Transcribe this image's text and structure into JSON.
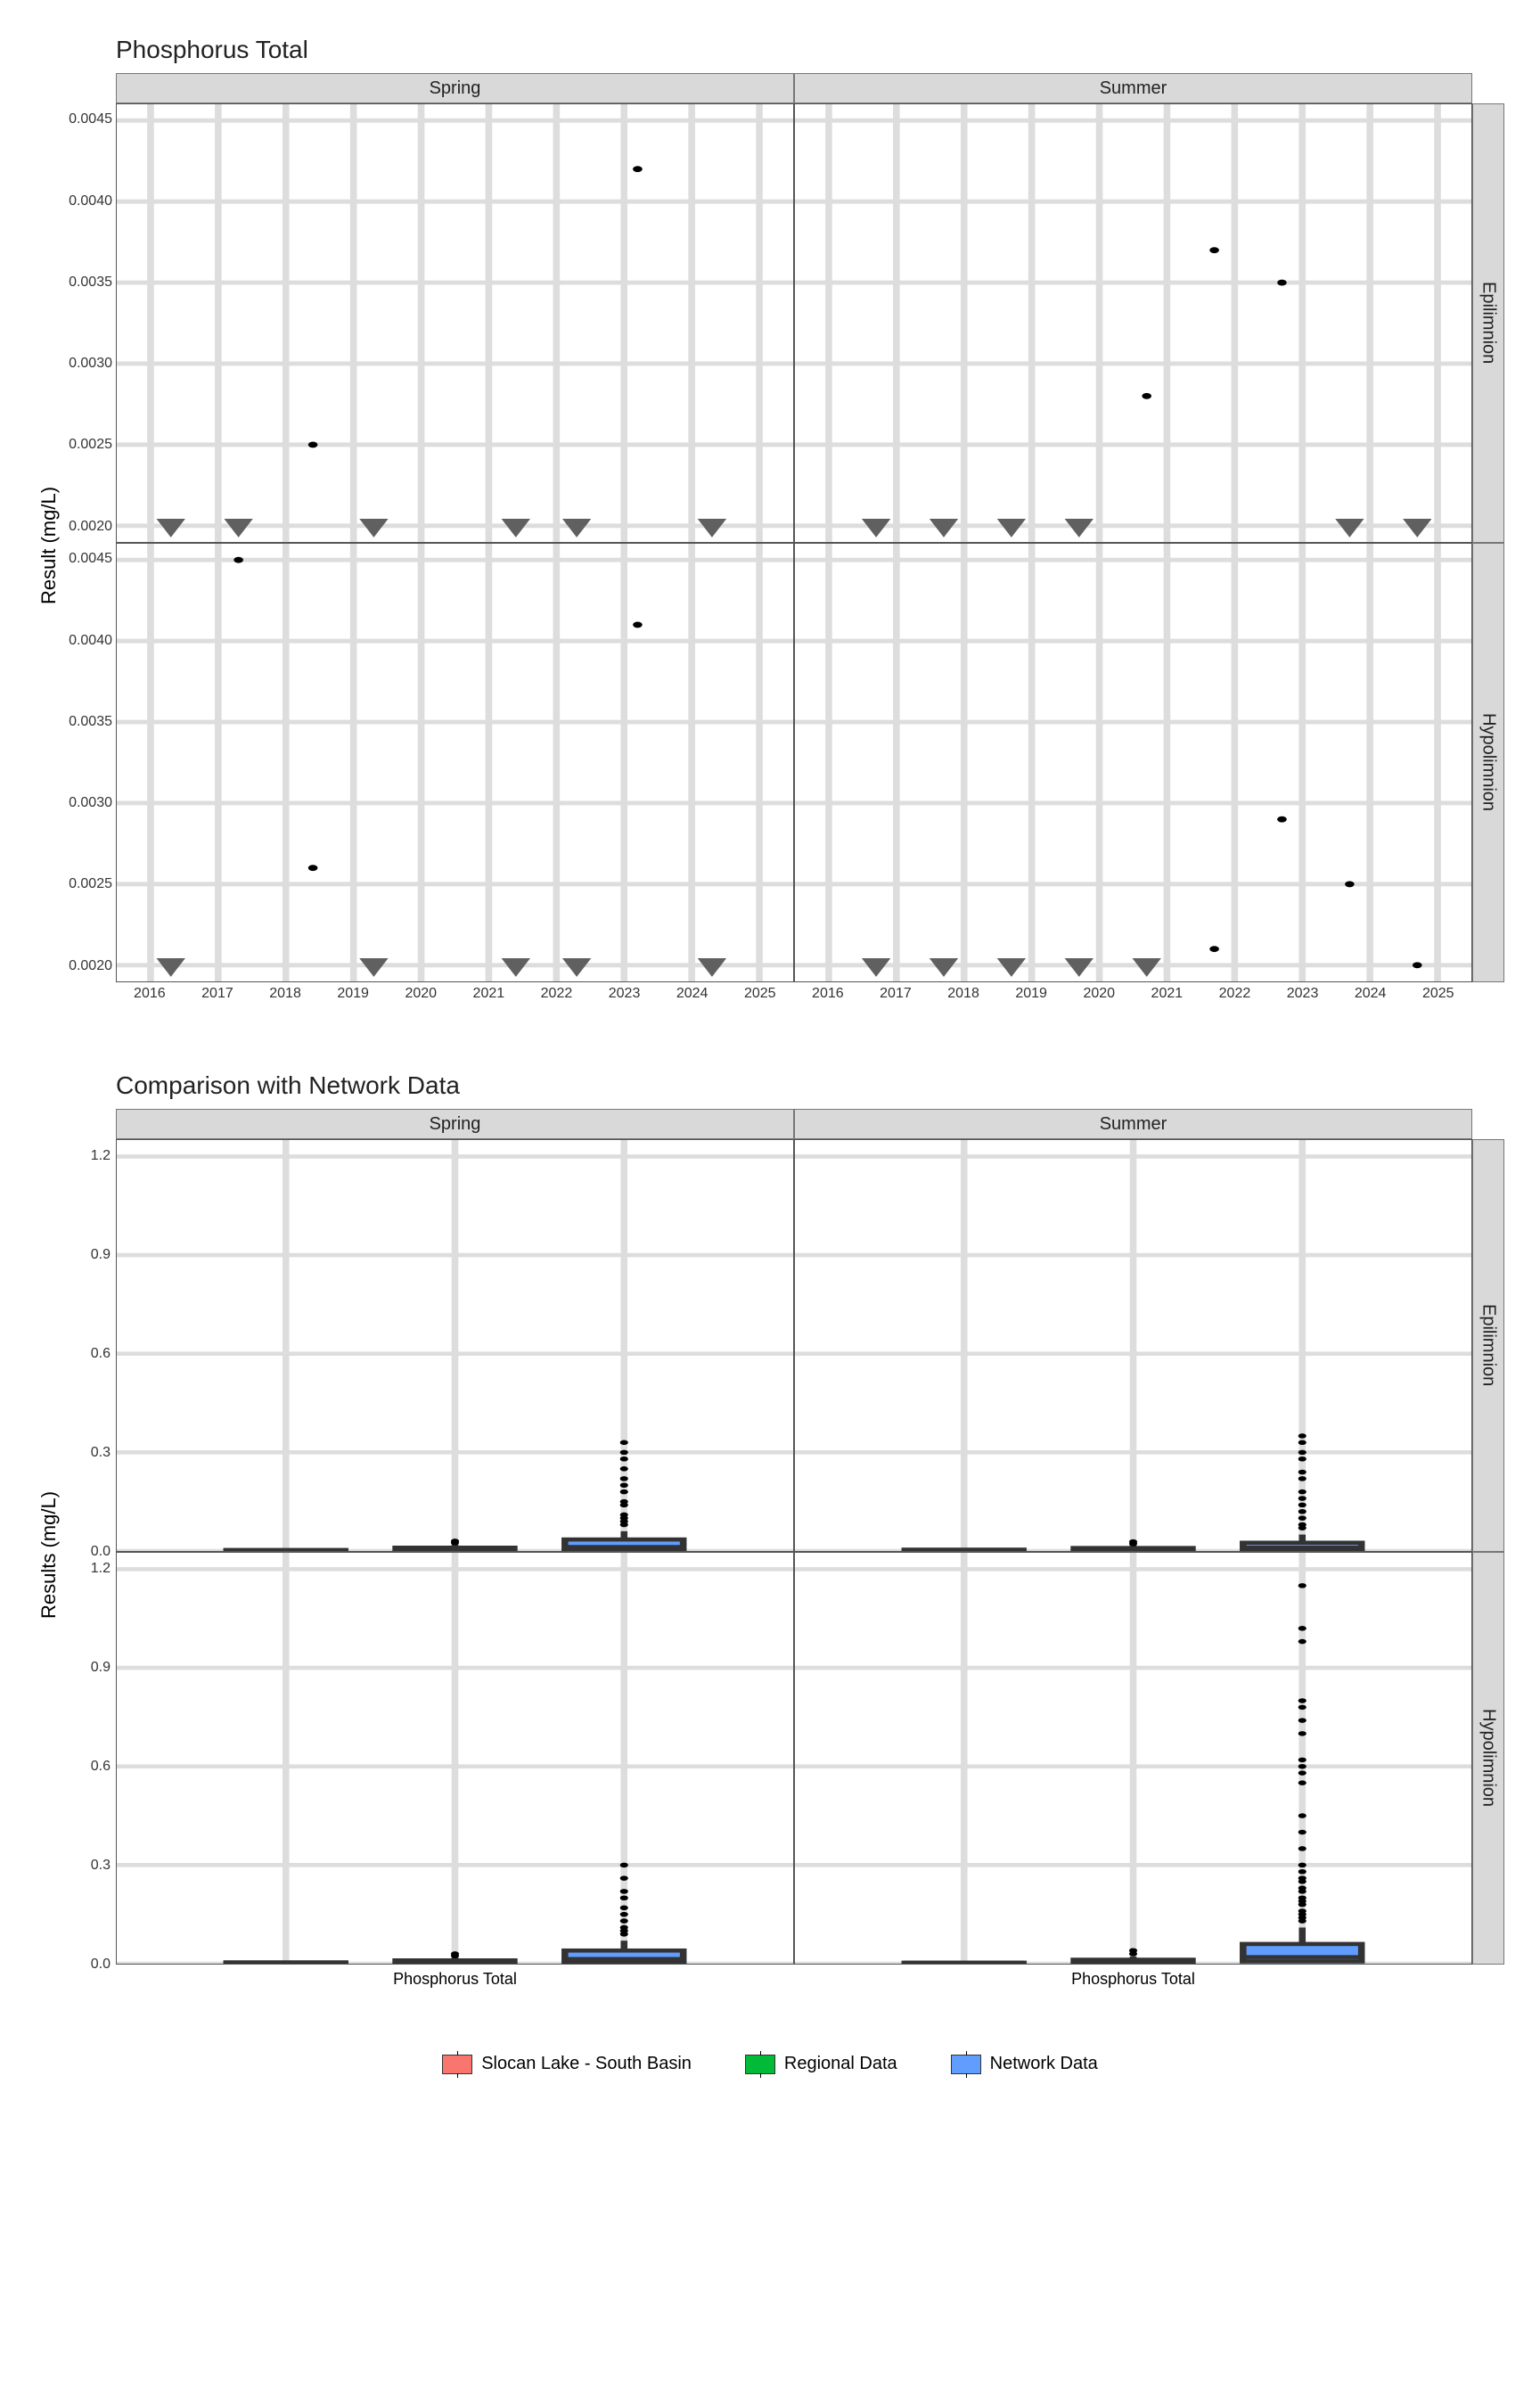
{
  "chart_data": [
    {
      "type": "scatter",
      "title": "Phosphorus Total",
      "ylabel": "Result (mg/L)",
      "xlabel": "",
      "xlim": [
        2015.5,
        2025.5
      ],
      "ylim": [
        0.0019,
        0.0046
      ],
      "x_ticks": [
        2016,
        2017,
        2018,
        2019,
        2020,
        2021,
        2022,
        2023,
        2024,
        2025
      ],
      "y_ticks": [
        0.002,
        0.0025,
        0.003,
        0.0035,
        0.004,
        0.0045
      ],
      "facets_col": [
        "Spring",
        "Summer"
      ],
      "facets_row": [
        "Epilimnion",
        "Hypolimnion"
      ],
      "panels": {
        "Spring|Epilimnion": {
          "solid": [
            {
              "x": 2018.4,
              "y": 0.0025
            },
            {
              "x": 2023.2,
              "y": 0.0042
            }
          ],
          "below_dl": [
            {
              "x": 2016.3,
              "y": 0.002
            },
            {
              "x": 2017.3,
              "y": 0.002
            },
            {
              "x": 2019.3,
              "y": 0.002
            },
            {
              "x": 2021.4,
              "y": 0.002
            },
            {
              "x": 2022.3,
              "y": 0.002
            },
            {
              "x": 2024.3,
              "y": 0.002
            }
          ]
        },
        "Summer|Epilimnion": {
          "solid": [
            {
              "x": 2020.7,
              "y": 0.0028
            },
            {
              "x": 2021.7,
              "y": 0.0037
            },
            {
              "x": 2022.7,
              "y": 0.0035
            }
          ],
          "below_dl": [
            {
              "x": 2016.7,
              "y": 0.002
            },
            {
              "x": 2017.7,
              "y": 0.002
            },
            {
              "x": 2018.7,
              "y": 0.002
            },
            {
              "x": 2019.7,
              "y": 0.002
            },
            {
              "x": 2023.7,
              "y": 0.002
            },
            {
              "x": 2024.7,
              "y": 0.002
            }
          ]
        },
        "Spring|Hypolimnion": {
          "solid": [
            {
              "x": 2017.3,
              "y": 0.0045
            },
            {
              "x": 2018.4,
              "y": 0.0026
            },
            {
              "x": 2023.2,
              "y": 0.0041
            }
          ],
          "below_dl": [
            {
              "x": 2016.3,
              "y": 0.002
            },
            {
              "x": 2019.3,
              "y": 0.002
            },
            {
              "x": 2021.4,
              "y": 0.002
            },
            {
              "x": 2022.3,
              "y": 0.002
            },
            {
              "x": 2024.3,
              "y": 0.002
            }
          ]
        },
        "Summer|Hypolimnion": {
          "solid": [
            {
              "x": 2021.7,
              "y": 0.0021
            },
            {
              "x": 2022.7,
              "y": 0.0029
            },
            {
              "x": 2023.7,
              "y": 0.0025
            },
            {
              "x": 2024.7,
              "y": 0.002
            }
          ],
          "below_dl": [
            {
              "x": 2016.7,
              "y": 0.002
            },
            {
              "x": 2017.7,
              "y": 0.002
            },
            {
              "x": 2018.7,
              "y": 0.002
            },
            {
              "x": 2019.7,
              "y": 0.002
            },
            {
              "x": 2020.7,
              "y": 0.002
            }
          ]
        }
      }
    },
    {
      "type": "boxplot",
      "title": "Comparison with Network Data",
      "ylabel": "Results (mg/L)",
      "xlabel": "Phosphorus Total",
      "ylim": [
        0,
        1.25
      ],
      "y_ticks": [
        0.0,
        0.3,
        0.6,
        0.9,
        1.2
      ],
      "facets_col": [
        "Spring",
        "Summer"
      ],
      "facets_row": [
        "Epilimnion",
        "Hypolimnion"
      ],
      "categories": [
        "Slocan Lake - South Basin",
        "Regional Data",
        "Network Data"
      ],
      "colors": {
        "Slocan Lake - South Basin": "#f8766d",
        "Regional Data": "#00ba38",
        "Network Data": "#619cff"
      },
      "panels": {
        "Spring|Epilimnion": {
          "boxes": [
            {
              "cat": "Slocan Lake - South Basin",
              "q1": 0.002,
              "med": 0.002,
              "q3": 0.003,
              "lo": 0.002,
              "hi": 0.004,
              "outliers": []
            },
            {
              "cat": "Regional Data",
              "q1": 0.003,
              "med": 0.005,
              "q3": 0.01,
              "lo": 0.002,
              "hi": 0.02,
              "outliers": [
                0.025,
                0.03
              ]
            },
            {
              "cat": "Network Data",
              "q1": 0.005,
              "med": 0.012,
              "q3": 0.035,
              "lo": 0.002,
              "hi": 0.06,
              "outliers": [
                0.08,
                0.09,
                0.1,
                0.11,
                0.14,
                0.15,
                0.18,
                0.2,
                0.22,
                0.25,
                0.28,
                0.3,
                0.33
              ]
            }
          ]
        },
        "Summer|Epilimnion": {
          "boxes": [
            {
              "cat": "Slocan Lake - South Basin",
              "q1": 0.002,
              "med": 0.003,
              "q3": 0.004,
              "lo": 0.002,
              "hi": 0.004,
              "outliers": []
            },
            {
              "cat": "Regional Data",
              "q1": 0.003,
              "med": 0.005,
              "q3": 0.009,
              "lo": 0.002,
              "hi": 0.018,
              "outliers": [
                0.022,
                0.028
              ]
            },
            {
              "cat": "Network Data",
              "q1": 0.004,
              "med": 0.01,
              "q3": 0.025,
              "lo": 0.002,
              "hi": 0.05,
              "outliers": [
                0.07,
                0.08,
                0.1,
                0.12,
                0.14,
                0.16,
                0.18,
                0.22,
                0.24,
                0.28,
                0.3,
                0.33,
                0.35
              ]
            }
          ]
        },
        "Spring|Hypolimnion": {
          "boxes": [
            {
              "cat": "Slocan Lake - South Basin",
              "q1": 0.002,
              "med": 0.002,
              "q3": 0.004,
              "lo": 0.002,
              "hi": 0.005,
              "outliers": []
            },
            {
              "cat": "Regional Data",
              "q1": 0.003,
              "med": 0.005,
              "q3": 0.01,
              "lo": 0.002,
              "hi": 0.02,
              "outliers": [
                0.024,
                0.03
              ]
            },
            {
              "cat": "Network Data",
              "q1": 0.005,
              "med": 0.014,
              "q3": 0.04,
              "lo": 0.002,
              "hi": 0.07,
              "outliers": [
                0.09,
                0.1,
                0.11,
                0.13,
                0.15,
                0.17,
                0.2,
                0.22,
                0.26,
                0.3
              ]
            }
          ]
        },
        "Summer|Hypolimnion": {
          "boxes": [
            {
              "cat": "Slocan Lake - South Basin",
              "q1": 0.002,
              "med": 0.003,
              "q3": 0.003,
              "lo": 0.002,
              "hi": 0.004,
              "outliers": []
            },
            {
              "cat": "Regional Data",
              "q1": 0.003,
              "med": 0.006,
              "q3": 0.012,
              "lo": 0.002,
              "hi": 0.022,
              "outliers": [
                0.03,
                0.04
              ]
            },
            {
              "cat": "Network Data",
              "q1": 0.007,
              "med": 0.02,
              "q3": 0.06,
              "lo": 0.002,
              "hi": 0.11,
              "outliers": [
                0.13,
                0.14,
                0.15,
                0.16,
                0.18,
                0.19,
                0.2,
                0.22,
                0.23,
                0.25,
                0.26,
                0.28,
                0.3,
                0.35,
                0.4,
                0.45,
                0.55,
                0.58,
                0.6,
                0.62,
                0.7,
                0.74,
                0.78,
                0.8,
                0.98,
                1.02,
                1.15
              ]
            }
          ]
        }
      }
    }
  ],
  "legend": {
    "items": [
      {
        "label": "Slocan Lake - South Basin",
        "color": "#f8766d"
      },
      {
        "label": "Regional Data",
        "color": "#00ba38"
      },
      {
        "label": "Network Data",
        "color": "#619cff"
      }
    ]
  }
}
